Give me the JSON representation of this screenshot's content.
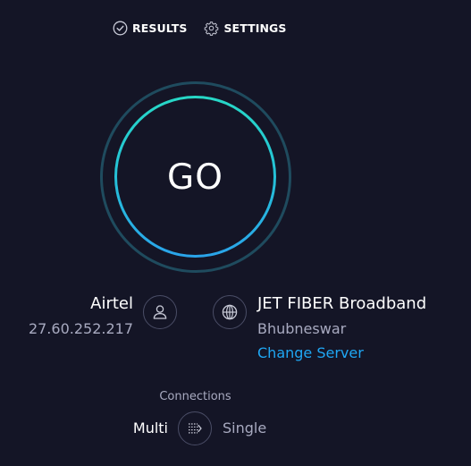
{
  "nav": {
    "results_label": "RESULTS",
    "settings_label": "SETTINGS"
  },
  "go_button": {
    "label": "GO"
  },
  "isp": {
    "name": "Airtel",
    "ip": "27.60.252.217",
    "icon": "user-icon"
  },
  "server": {
    "name": "JET FIBER Broadband",
    "location": "Bhubneswar",
    "change_label": "Change Server",
    "icon": "globe-icon"
  },
  "connections": {
    "label": "Connections",
    "multi_label": "Multi",
    "single_label": "Single",
    "selected": "Multi",
    "icon": "connections-toggle-icon"
  },
  "colors": {
    "background": "#141526",
    "ring_gradient_start": "#27d8c6",
    "ring_gradient_end": "#2aa4ea",
    "outer_ring": "#1f4b5e",
    "link": "#1fa7f4",
    "muted_text": "#a8aac0"
  }
}
